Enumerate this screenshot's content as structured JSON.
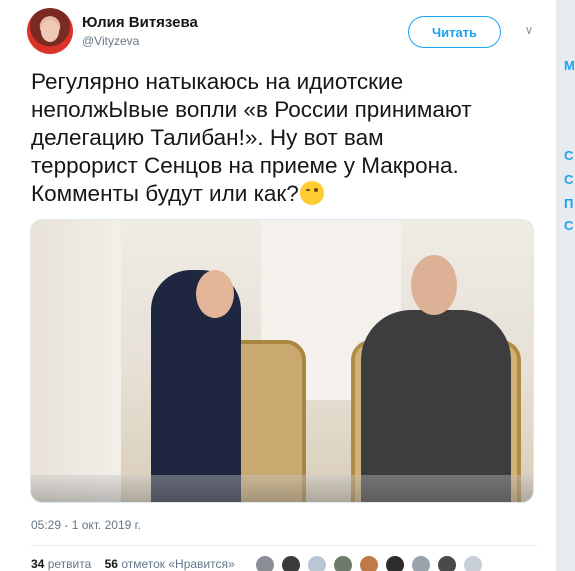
{
  "author": {
    "name": "Юлия Витязева",
    "handle": "@Vityzeva"
  },
  "actions": {
    "follow_label": "Читать",
    "more_icon": "chevron-down-icon"
  },
  "tweet": {
    "lines": [
      "Регулярно натыкаюсь на идиотские",
      "неполжЫвые вопли «в России принимают",
      "делегацию Талибан!». Ну вот вам",
      "террорист Сенцов на приеме у Макрона.",
      "Комменты будут или как?"
    ],
    "emoji": "winking-face-emoji",
    "timestamp": "05:29 - 1 окт. 2019 г."
  },
  "stats": {
    "retweets_count": "34",
    "retweets_label": "ретвита",
    "likes_count": "56",
    "likes_label": "отметок «Нравится»"
  },
  "likers": [
    "#8a8f96",
    "#3b3b3b",
    "#b9c7d4",
    "#6f7a6a",
    "#c07a4a",
    "#2d2d2d",
    "#9aa3ad",
    "#4a4a4a",
    "#c9cfd6"
  ],
  "sidebar_letters": [
    "М",
    "С",
    "С",
    "П",
    "С"
  ],
  "colors": {
    "accent": "#1da1f2",
    "secondary_text": "#657786"
  }
}
